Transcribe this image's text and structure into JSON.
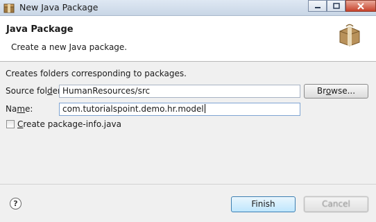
{
  "window": {
    "title": "New Java Package"
  },
  "header": {
    "title": "Java Package",
    "description": "Create a new Java package."
  },
  "form": {
    "intro": "Creates folders corresponding to packages.",
    "source_folder": {
      "label_prefix": "Source fol",
      "label_mnemonic": "d",
      "label_suffix": "er:",
      "value": "HumanResources/src",
      "browse_prefix": "Br",
      "browse_mnemonic": "o",
      "browse_suffix": "wse..."
    },
    "name": {
      "label_prefix": "Na",
      "label_mnemonic": "m",
      "label_suffix": "e:",
      "value": "com.tutorialspoint.demo.hr.model"
    },
    "package_info": {
      "label_mnemonic": "C",
      "label_rest": "reate package-info.java",
      "checked": false
    }
  },
  "footer": {
    "help_glyph": "?",
    "finish_label": "Finish",
    "cancel_label": "Cancel"
  },
  "icons": {
    "app": "java-package-wizard-icon",
    "banner": "package-box-icon",
    "help": "help-icon"
  },
  "colors": {
    "title_bar": "#c9d6e6",
    "close_button": "#c7432c",
    "default_button": "#bee6fd"
  }
}
